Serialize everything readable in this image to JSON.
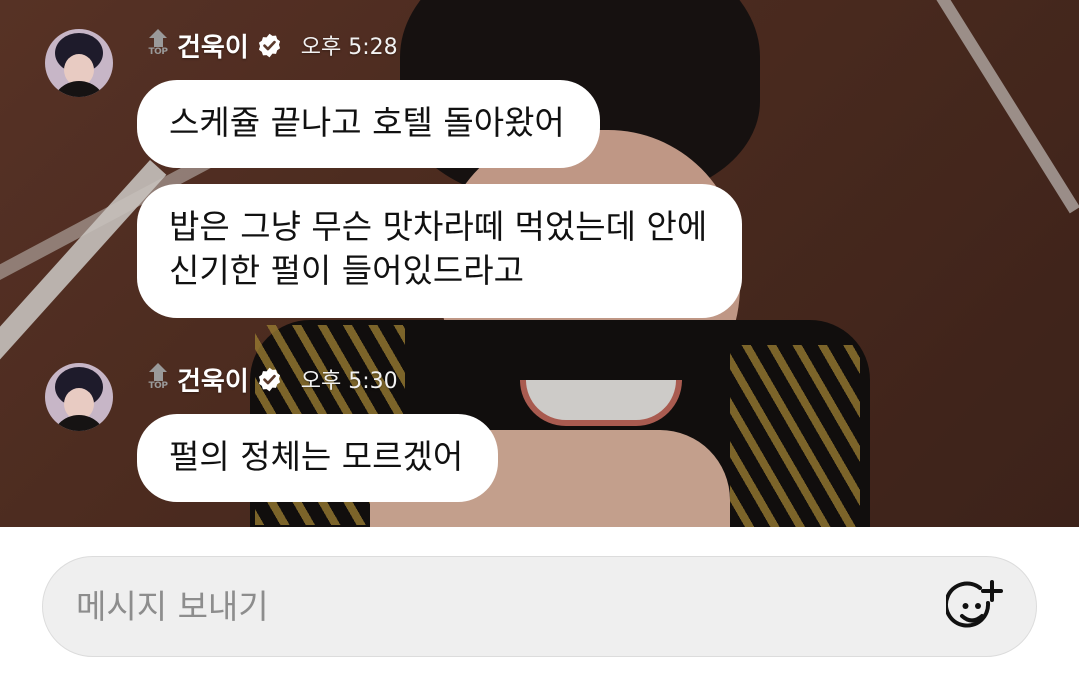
{
  "messages": [
    {
      "sender": {
        "badge": "TOP",
        "name": "건욱이",
        "verified_icon": "verified-check-icon",
        "time": "오후 5:28"
      },
      "bubbles": [
        "스케쥴 끝나고 호텔 돌아왔어",
        "밥은 그냥 무슨 맛차라떼 먹었는데 안에\n신기한 펄이 들어있드라고"
      ]
    },
    {
      "sender": {
        "badge": "TOP",
        "name": "건욱이",
        "verified_icon": "verified-check-icon",
        "time": "오후 5:30"
      },
      "bubbles": [
        "펄의 정체는 모르겠어"
      ]
    }
  ],
  "composer": {
    "placeholder": "메시지 보내기",
    "emoji_icon": "add-emoji-icon"
  },
  "colors": {
    "bubble": "#ffffff",
    "composer_field": "#efefef",
    "placeholder_text": "#8d8d8d",
    "username": "#ffffff"
  }
}
